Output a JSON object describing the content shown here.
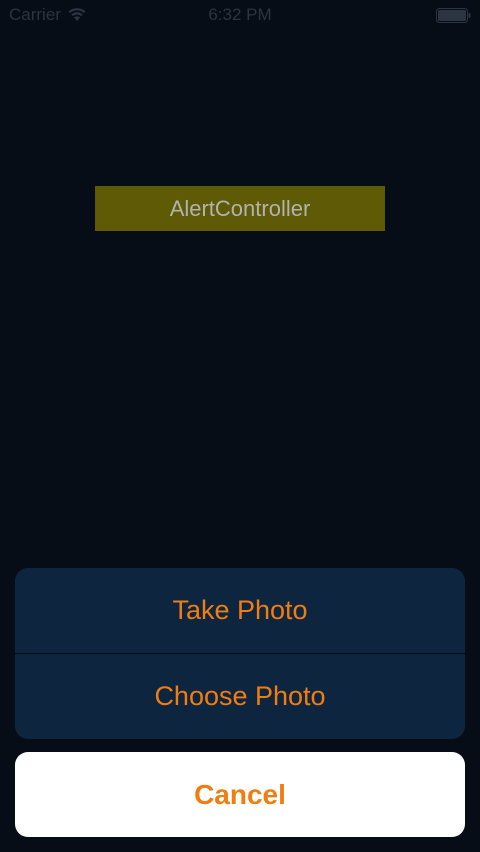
{
  "status_bar": {
    "carrier": "Carrier",
    "time": "6:32 PM",
    "wifi_icon": "wifi-icon",
    "battery_icon": "battery-icon"
  },
  "main": {
    "alert_button_label": "AlertController"
  },
  "action_sheet": {
    "actions": [
      {
        "label": "Take Photo"
      },
      {
        "label": "Choose Photo"
      }
    ],
    "cancel_label": "Cancel"
  },
  "colors": {
    "background": "#060d16",
    "alert_button_bg": "#5e5a06",
    "sheet_bg": "#0e2540",
    "action_text": "#f07d12",
    "cancel_bg": "#ffffff"
  }
}
